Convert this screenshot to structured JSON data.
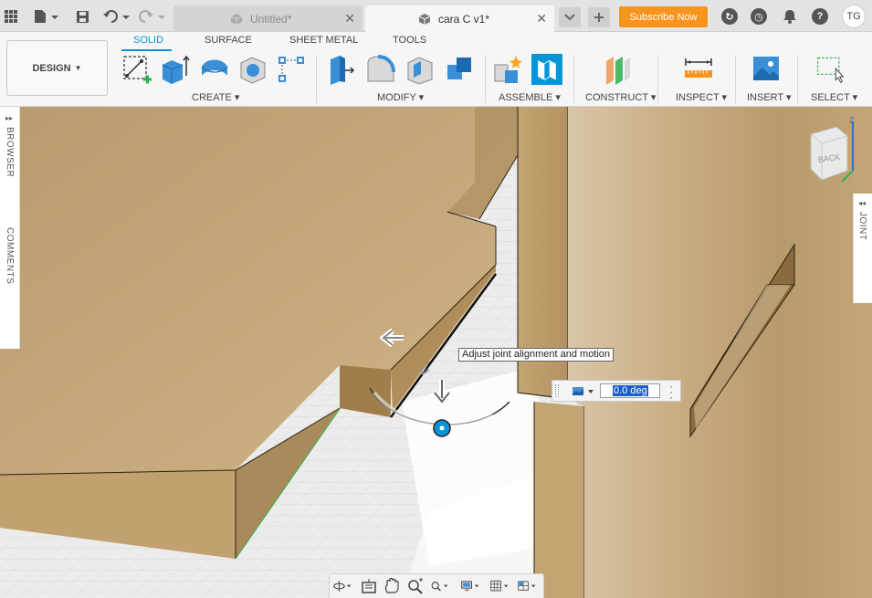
{
  "tabs": [
    {
      "label": "Untitled*",
      "active": false
    },
    {
      "label": "cara C v1*",
      "active": true
    }
  ],
  "subscribe_label": "Subscribe Now",
  "user_initials": "TG",
  "workspace_label": "DESIGN",
  "ribbon_tabs": [
    "SOLID",
    "SURFACE",
    "SHEET METAL",
    "TOOLS"
  ],
  "groups": {
    "create": "CREATE",
    "modify": "MODIFY",
    "assemble": "ASSEMBLE",
    "construct": "CONSTRUCT",
    "inspect": "INSPECT",
    "insert": "INSERT",
    "select": "SELECT"
  },
  "left_panels": {
    "browser": "BROWSER",
    "comments": "COMMENTS"
  },
  "right_panel": "JOINT",
  "viewcube_face": "BACK",
  "viewcube_axis": "Z",
  "tooltip": "Adjust joint alignment and motion",
  "angle_value": "0.0 deg",
  "colors": {
    "accent": "#0696d7",
    "subscribe": "#f7941d",
    "wood": "#c9a978"
  }
}
